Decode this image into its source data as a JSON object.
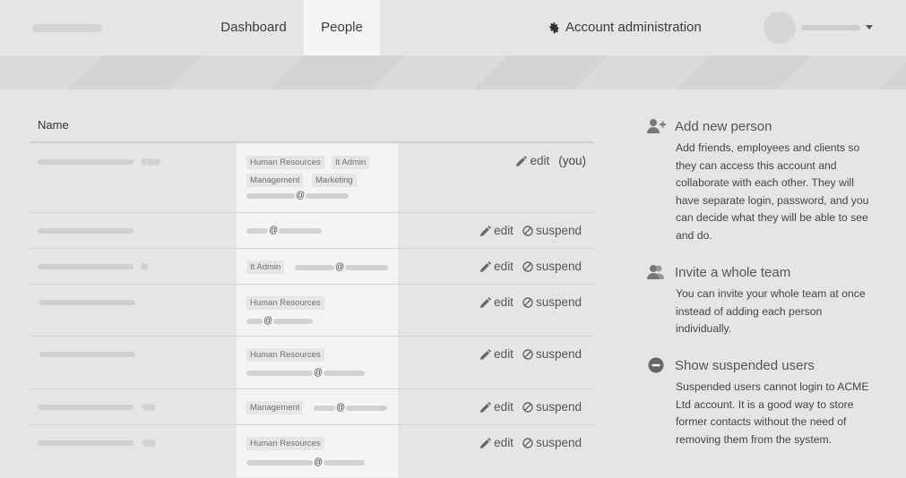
{
  "nav": {
    "dashboard": "Dashboard",
    "people": "People",
    "account": "Account administration",
    "account_icon": "gear-icon"
  },
  "table": {
    "name_header": "Name",
    "edit_label": "edit",
    "suspend_label": "suspend",
    "you_label": "(you)",
    "email_at": "@",
    "rows": [
      {
        "tags": [
          "Human Resources",
          "It Admin",
          "Management",
          "Marketing"
        ]
      },
      {
        "tags": []
      },
      {
        "tags": [
          "It Admin"
        ]
      },
      {
        "tags": [
          "Human Resources"
        ]
      },
      {
        "tags": [
          "Human Resources"
        ]
      },
      {
        "tags": [
          "Management"
        ]
      },
      {
        "tags": [
          "Human Resources"
        ]
      }
    ]
  },
  "sidebar": {
    "add": {
      "title": "Add new person",
      "text": "Add friends, employees and clients so they can access this account and collaborate with each other. They will have separate login, password, and you can decide what they will be able to see and do.",
      "icon": "add-user-icon"
    },
    "invite": {
      "title": "Invite a whole team",
      "text": "You can invite your whole team at once instead of adding each person individually.",
      "icon": "team-icon"
    },
    "suspended": {
      "title": "Show suspended users",
      "text": "Suspended users cannot login to ACME Ltd account. It is a good way to store former contacts without the need of removing them from the system.",
      "icon": "minus-circle-icon"
    }
  }
}
